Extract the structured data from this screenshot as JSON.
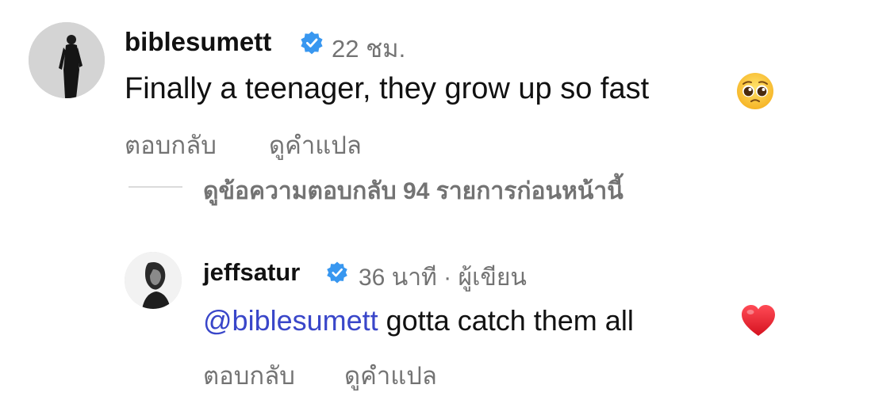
{
  "comment": {
    "username": "biblesumett",
    "time": "22 ชม.",
    "text": "Finally a teenager, they grow up so fast",
    "emoji": "pleading-face",
    "reply_label": "ตอบกลับ",
    "translate_label": "ดูคำแปล"
  },
  "view_replies_label": "ดูข้อความตอบกลับ 94 รายการก่อนหน้านี้",
  "reply": {
    "username": "jeffsatur",
    "meta": "36 นาที · ผู้เขียน",
    "mention": "@biblesumett",
    "text": " gotta catch them all",
    "emoji": "red-heart",
    "reply_label": "ตอบกลับ",
    "translate_label": "ดูคำแปล"
  },
  "colors": {
    "verified": "#3897f0",
    "secondary_text": "#737373",
    "mention": "#3946c9",
    "heart": "#e8202f"
  }
}
